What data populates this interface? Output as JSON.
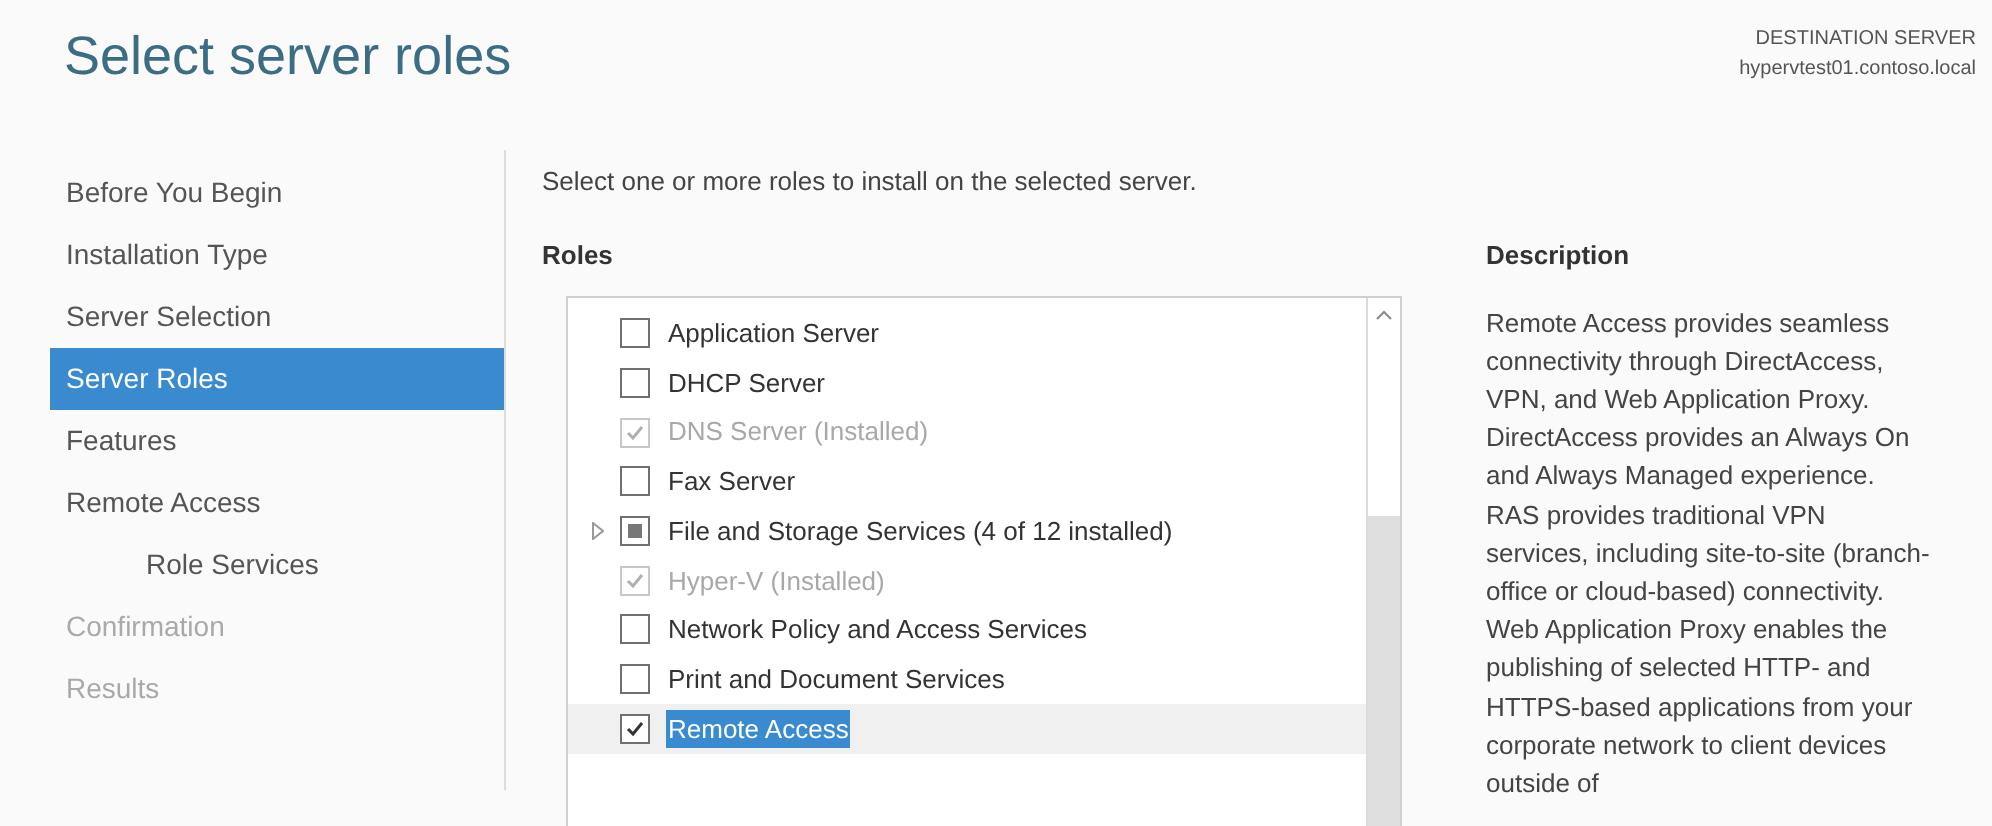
{
  "title": "Select server roles",
  "destination": {
    "label": "DESTINATION SERVER",
    "server": "hypervtest01.contoso.local"
  },
  "sidebar": {
    "items": [
      {
        "label": "Before You Begin",
        "selected": false,
        "disabled": false
      },
      {
        "label": "Installation Type",
        "selected": false,
        "disabled": false
      },
      {
        "label": "Server Selection",
        "selected": false,
        "disabled": false
      },
      {
        "label": "Server Roles",
        "selected": true,
        "disabled": false
      },
      {
        "label": "Features",
        "selected": false,
        "disabled": false
      },
      {
        "label": "Remote Access",
        "selected": false,
        "disabled": false,
        "children": [
          {
            "label": "Role Services",
            "selected": false,
            "disabled": false
          }
        ]
      },
      {
        "label": "Confirmation",
        "selected": false,
        "disabled": true
      },
      {
        "label": "Results",
        "selected": false,
        "disabled": true
      }
    ]
  },
  "instruction": "Select one or more roles to install on the selected server.",
  "roles": {
    "heading": "Roles",
    "items": [
      {
        "label": "Application Server",
        "checked": false,
        "indeterminate": false,
        "disabled": false,
        "expandable": false,
        "selected": false
      },
      {
        "label": "DHCP Server",
        "checked": false,
        "indeterminate": false,
        "disabled": false,
        "expandable": false,
        "selected": false
      },
      {
        "label": "DNS Server (Installed)",
        "checked": true,
        "indeterminate": false,
        "disabled": true,
        "expandable": false,
        "selected": false
      },
      {
        "label": "Fax Server",
        "checked": false,
        "indeterminate": false,
        "disabled": false,
        "expandable": false,
        "selected": false
      },
      {
        "label": "File and Storage Services (4 of 12 installed)",
        "checked": false,
        "indeterminate": true,
        "disabled": false,
        "expandable": true,
        "selected": false
      },
      {
        "label": "Hyper-V (Installed)",
        "checked": true,
        "indeterminate": false,
        "disabled": true,
        "expandable": false,
        "selected": false
      },
      {
        "label": "Network Policy and Access Services",
        "checked": false,
        "indeterminate": false,
        "disabled": false,
        "expandable": false,
        "selected": false
      },
      {
        "label": "Print and Document Services",
        "checked": false,
        "indeterminate": false,
        "disabled": false,
        "expandable": false,
        "selected": false
      },
      {
        "label": "Remote Access",
        "checked": true,
        "indeterminate": false,
        "disabled": false,
        "expandable": false,
        "selected": true
      }
    ]
  },
  "description": {
    "heading": "Description",
    "text": "Remote Access provides seamless connectivity through DirectAccess, VPN, and Web Application Proxy. DirectAccess provides an Always On and Always Managed experience. RAS provides traditional VPN services, including site-to-site (branch-office or cloud-based) connectivity. Web Application Proxy enables the publishing of selected HTTP- and HTTPS-based applications from your corporate network to client devices outside of"
  }
}
